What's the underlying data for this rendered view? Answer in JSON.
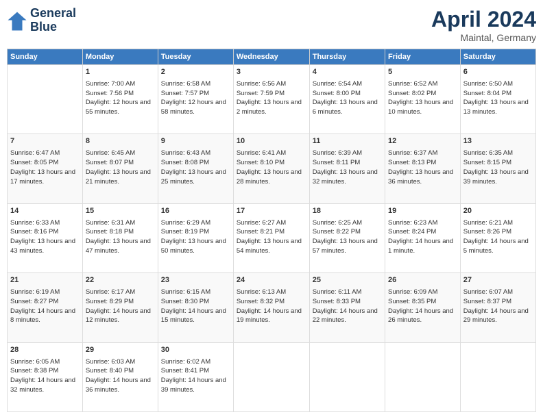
{
  "header": {
    "logo_line1": "General",
    "logo_line2": "Blue",
    "month": "April 2024",
    "location": "Maintal, Germany"
  },
  "columns": [
    "Sunday",
    "Monday",
    "Tuesday",
    "Wednesday",
    "Thursday",
    "Friday",
    "Saturday"
  ],
  "weeks": [
    [
      {
        "day": "",
        "sunrise": "",
        "sunset": "",
        "daylight": ""
      },
      {
        "day": "1",
        "sunrise": "Sunrise: 7:00 AM",
        "sunset": "Sunset: 7:56 PM",
        "daylight": "Daylight: 12 hours and 55 minutes."
      },
      {
        "day": "2",
        "sunrise": "Sunrise: 6:58 AM",
        "sunset": "Sunset: 7:57 PM",
        "daylight": "Daylight: 12 hours and 58 minutes."
      },
      {
        "day": "3",
        "sunrise": "Sunrise: 6:56 AM",
        "sunset": "Sunset: 7:59 PM",
        "daylight": "Daylight: 13 hours and 2 minutes."
      },
      {
        "day": "4",
        "sunrise": "Sunrise: 6:54 AM",
        "sunset": "Sunset: 8:00 PM",
        "daylight": "Daylight: 13 hours and 6 minutes."
      },
      {
        "day": "5",
        "sunrise": "Sunrise: 6:52 AM",
        "sunset": "Sunset: 8:02 PM",
        "daylight": "Daylight: 13 hours and 10 minutes."
      },
      {
        "day": "6",
        "sunrise": "Sunrise: 6:50 AM",
        "sunset": "Sunset: 8:04 PM",
        "daylight": "Daylight: 13 hours and 13 minutes."
      }
    ],
    [
      {
        "day": "7",
        "sunrise": "Sunrise: 6:47 AM",
        "sunset": "Sunset: 8:05 PM",
        "daylight": "Daylight: 13 hours and 17 minutes."
      },
      {
        "day": "8",
        "sunrise": "Sunrise: 6:45 AM",
        "sunset": "Sunset: 8:07 PM",
        "daylight": "Daylight: 13 hours and 21 minutes."
      },
      {
        "day": "9",
        "sunrise": "Sunrise: 6:43 AM",
        "sunset": "Sunset: 8:08 PM",
        "daylight": "Daylight: 13 hours and 25 minutes."
      },
      {
        "day": "10",
        "sunrise": "Sunrise: 6:41 AM",
        "sunset": "Sunset: 8:10 PM",
        "daylight": "Daylight: 13 hours and 28 minutes."
      },
      {
        "day": "11",
        "sunrise": "Sunrise: 6:39 AM",
        "sunset": "Sunset: 8:11 PM",
        "daylight": "Daylight: 13 hours and 32 minutes."
      },
      {
        "day": "12",
        "sunrise": "Sunrise: 6:37 AM",
        "sunset": "Sunset: 8:13 PM",
        "daylight": "Daylight: 13 hours and 36 minutes."
      },
      {
        "day": "13",
        "sunrise": "Sunrise: 6:35 AM",
        "sunset": "Sunset: 8:15 PM",
        "daylight": "Daylight: 13 hours and 39 minutes."
      }
    ],
    [
      {
        "day": "14",
        "sunrise": "Sunrise: 6:33 AM",
        "sunset": "Sunset: 8:16 PM",
        "daylight": "Daylight: 13 hours and 43 minutes."
      },
      {
        "day": "15",
        "sunrise": "Sunrise: 6:31 AM",
        "sunset": "Sunset: 8:18 PM",
        "daylight": "Daylight: 13 hours and 47 minutes."
      },
      {
        "day": "16",
        "sunrise": "Sunrise: 6:29 AM",
        "sunset": "Sunset: 8:19 PM",
        "daylight": "Daylight: 13 hours and 50 minutes."
      },
      {
        "day": "17",
        "sunrise": "Sunrise: 6:27 AM",
        "sunset": "Sunset: 8:21 PM",
        "daylight": "Daylight: 13 hours and 54 minutes."
      },
      {
        "day": "18",
        "sunrise": "Sunrise: 6:25 AM",
        "sunset": "Sunset: 8:22 PM",
        "daylight": "Daylight: 13 hours and 57 minutes."
      },
      {
        "day": "19",
        "sunrise": "Sunrise: 6:23 AM",
        "sunset": "Sunset: 8:24 PM",
        "daylight": "Daylight: 14 hours and 1 minute."
      },
      {
        "day": "20",
        "sunrise": "Sunrise: 6:21 AM",
        "sunset": "Sunset: 8:26 PM",
        "daylight": "Daylight: 14 hours and 5 minutes."
      }
    ],
    [
      {
        "day": "21",
        "sunrise": "Sunrise: 6:19 AM",
        "sunset": "Sunset: 8:27 PM",
        "daylight": "Daylight: 14 hours and 8 minutes."
      },
      {
        "day": "22",
        "sunrise": "Sunrise: 6:17 AM",
        "sunset": "Sunset: 8:29 PM",
        "daylight": "Daylight: 14 hours and 12 minutes."
      },
      {
        "day": "23",
        "sunrise": "Sunrise: 6:15 AM",
        "sunset": "Sunset: 8:30 PM",
        "daylight": "Daylight: 14 hours and 15 minutes."
      },
      {
        "day": "24",
        "sunrise": "Sunrise: 6:13 AM",
        "sunset": "Sunset: 8:32 PM",
        "daylight": "Daylight: 14 hours and 19 minutes."
      },
      {
        "day": "25",
        "sunrise": "Sunrise: 6:11 AM",
        "sunset": "Sunset: 8:33 PM",
        "daylight": "Daylight: 14 hours and 22 minutes."
      },
      {
        "day": "26",
        "sunrise": "Sunrise: 6:09 AM",
        "sunset": "Sunset: 8:35 PM",
        "daylight": "Daylight: 14 hours and 26 minutes."
      },
      {
        "day": "27",
        "sunrise": "Sunrise: 6:07 AM",
        "sunset": "Sunset: 8:37 PM",
        "daylight": "Daylight: 14 hours and 29 minutes."
      }
    ],
    [
      {
        "day": "28",
        "sunrise": "Sunrise: 6:05 AM",
        "sunset": "Sunset: 8:38 PM",
        "daylight": "Daylight: 14 hours and 32 minutes."
      },
      {
        "day": "29",
        "sunrise": "Sunrise: 6:03 AM",
        "sunset": "Sunset: 8:40 PM",
        "daylight": "Daylight: 14 hours and 36 minutes."
      },
      {
        "day": "30",
        "sunrise": "Sunrise: 6:02 AM",
        "sunset": "Sunset: 8:41 PM",
        "daylight": "Daylight: 14 hours and 39 minutes."
      },
      {
        "day": "",
        "sunrise": "",
        "sunset": "",
        "daylight": ""
      },
      {
        "day": "",
        "sunrise": "",
        "sunset": "",
        "daylight": ""
      },
      {
        "day": "",
        "sunrise": "",
        "sunset": "",
        "daylight": ""
      },
      {
        "day": "",
        "sunrise": "",
        "sunset": "",
        "daylight": ""
      }
    ]
  ]
}
